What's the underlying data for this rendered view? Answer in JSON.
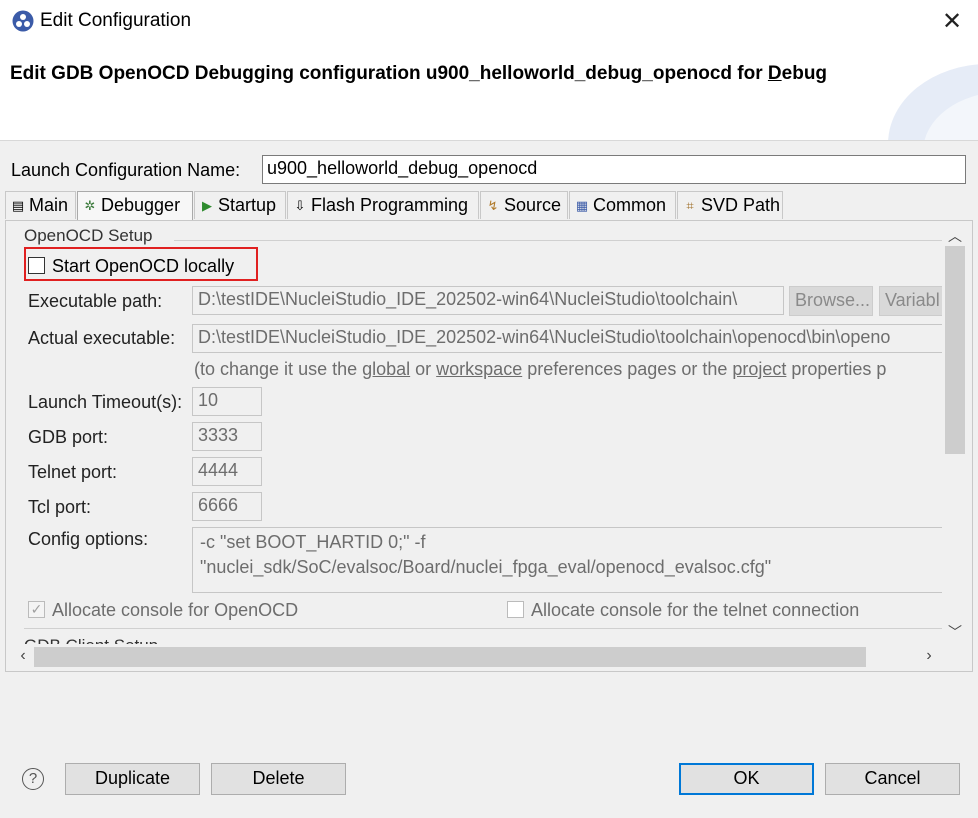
{
  "window": {
    "title": "Edit Configuration",
    "close_glyph": "✕"
  },
  "header": {
    "title_prefix": "Edit GDB OpenOCD Debugging configuration u900_helloworld_debug_openocd for ",
    "title_mnemonic": "D",
    "title_suffix": "ebug"
  },
  "launch_config": {
    "label": "Launch Configuration Name:",
    "value": "u900_helloworld_debug_openocd"
  },
  "tabs": [
    {
      "label": "Main",
      "icon": "main-tab-icon",
      "glyph": "▤",
      "active": false
    },
    {
      "label": "Debugger",
      "icon": "debugger-bug-icon",
      "glyph": "✲",
      "active": true
    },
    {
      "label": "Startup",
      "icon": "startup-play-icon",
      "glyph": "▶",
      "active": false
    },
    {
      "label": "Flash Programming",
      "icon": "flash-load-icon",
      "glyph": "⇩",
      "active": false
    },
    {
      "label": "Source",
      "icon": "source-icon",
      "glyph": "↯",
      "active": false
    },
    {
      "label": "Common",
      "icon": "common-icon",
      "glyph": "▦",
      "active": false
    },
    {
      "label": "SVD Path",
      "icon": "svd-tree-icon",
      "glyph": "⌗",
      "active": false
    }
  ],
  "openocd": {
    "group_label": "OpenOCD Setup",
    "start_locally": {
      "label": "Start OpenOCD locally",
      "checked": false
    },
    "executable_path": {
      "label": "Executable path:",
      "value": "D:\\testIDE\\NucleiStudio_IDE_202502-win64\\NucleiStudio\\toolchain\\",
      "browse": "Browse...",
      "variables": "Variabl"
    },
    "actual_executable": {
      "label": "Actual executable:",
      "value": "D:\\testIDE\\NucleiStudio_IDE_202502-win64\\NucleiStudio\\toolchain\\openocd\\bin\\openo"
    },
    "hint": {
      "prefix": "(to change it use the ",
      "global": "global",
      "or": " or ",
      "workspace": "workspace",
      "middle": " preferences pages or the ",
      "project": "project",
      "suffix": " properties p"
    },
    "launch_timeout": {
      "label": "Launch Timeout(s):",
      "value": "10"
    },
    "gdb_port": {
      "label": "GDB port:",
      "value": "3333"
    },
    "telnet_port": {
      "label": "Telnet port:",
      "value": "4444"
    },
    "tcl_port": {
      "label": "Tcl port:",
      "value": "6666"
    },
    "config_options": {
      "label": "Config options:",
      "line1": "-c \"set BOOT_HARTID 0;\" -f",
      "line2": "\"nuclei_sdk/SoC/evalsoc/Board/nuclei_fpga_eval/openocd_evalsoc.cfg\""
    },
    "allocate_console": {
      "label": "Allocate console for OpenOCD",
      "checked": true
    },
    "allocate_telnet": {
      "label": "Allocate console for the telnet connection",
      "checked": false
    }
  },
  "gdb_client": {
    "group_label": "GDB Client Setup"
  },
  "buttons": {
    "help": "?",
    "duplicate": "Duplicate",
    "delete": "Delete",
    "ok": "OK",
    "cancel": "Cancel"
  },
  "colors": {
    "highlight_box": "#e02020",
    "ok_border": "#0078d7",
    "app_icon": "#3b5ba8"
  }
}
